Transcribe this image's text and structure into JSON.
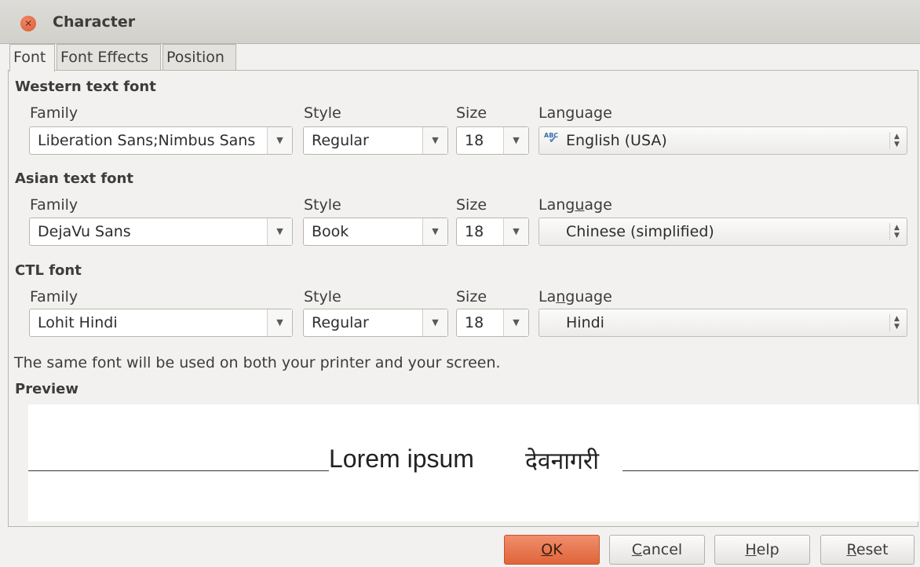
{
  "window": {
    "title": "Character"
  },
  "tabs": [
    {
      "label": "Font",
      "active": true
    },
    {
      "label": "Font Effects",
      "active": false
    },
    {
      "label": "Position",
      "active": false
    }
  ],
  "labels": {
    "family": "Family",
    "style": "Style",
    "size": "Size",
    "language_pre": "Lan",
    "language_mid": "g",
    "language_post": "uage",
    "language_asian_pre": "Lang",
    "language_asian_mid": "u",
    "language_asian_post": "age",
    "language_ctl_pre": "La",
    "language_ctl_mid": "n",
    "language_ctl_post": "guage"
  },
  "sections": {
    "western": {
      "title": "Western text font",
      "family": "Liberation Sans;Nimbus Sans",
      "style": "Regular",
      "size": "18",
      "language": "English (USA)",
      "language_icon": "spellcheck-abc-icon"
    },
    "asian": {
      "title": "Asian text font",
      "family": "DejaVu Sans",
      "style": "Book",
      "size": "18",
      "language": "Chinese (simplified)"
    },
    "ctl": {
      "title": "CTL font",
      "family": "Lohit Hindi",
      "style": "Regular",
      "size": "18",
      "language": "Hindi"
    }
  },
  "note": "The same font will be used on both your printer and your screen.",
  "preview": {
    "title": "Preview",
    "text_western": "Lorem ipsum",
    "text_ctl": "देवनागरी"
  },
  "buttons": {
    "ok_pre": "",
    "ok_mn": "O",
    "ok_post": "K",
    "cancel_mn": "C",
    "cancel_post": "ancel",
    "help_mn": "H",
    "help_post": "elp",
    "reset_mn": "R",
    "reset_post": "eset"
  },
  "colors": {
    "accent": "#e0643a",
    "window_bg": "#f2f1f0"
  }
}
